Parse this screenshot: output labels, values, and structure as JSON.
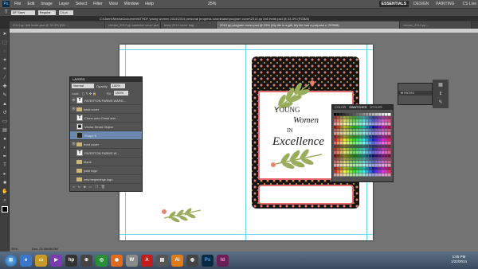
{
  "menubar": {
    "logo": "Ps",
    "items": [
      "File",
      "Edit",
      "Image",
      "Layer",
      "Select",
      "Filter",
      "View",
      "Window",
      "Help"
    ],
    "zoom": "25%",
    "workspaces": [
      "ESSENTIALS",
      "DESIGN",
      "PAINTING"
    ],
    "cs_live": "CS Live"
  },
  "options": {
    "font": "DF Sans",
    "style": "Regular",
    "size": "14 pt"
  },
  "path": "C:\\Users\\Nesha\\Documents\\THDF young women 2014\\2014 personal progress coordinator\\program cover\\2014 pp 4x6 invite.psd @ 33.3% (RGB/8)",
  "tabs": [
    "2014 pp 4x6 invite.psd @ 33.3% (RG…",
    "christo_2014 pp calendar cover.psd",
    "bday 2014 cover bag…",
    "2014 pp program cover.psd @ 25% (My life is a gift, My life has a purpose c, RGB/8)",
    "christo_2014 pp…"
  ],
  "active_tab": 3,
  "cover": {
    "line1": "YOUNG",
    "line2": "Women",
    "line3": "IN",
    "line4": "Excellence"
  },
  "layers": {
    "tabs": [
      "LAYERS"
    ],
    "mode": "Normal",
    "opacity_label": "Opacity:",
    "opacity": "100%",
    "lock_label": "Lock:",
    "fill_label": "Fill:",
    "fill": "100%",
    "rows": [
      {
        "name": "RIVERTON FARMS WARD…",
        "kind": "text"
      },
      {
        "name": "back cover",
        "kind": "folder"
      },
      {
        "name": "Come unto Christ and …",
        "kind": "text"
      },
      {
        "name": "Vector Smart Object",
        "kind": "smart"
      },
      {
        "name": "Shape 6",
        "kind": "shape"
      },
      {
        "name": "front cover",
        "kind": "folder"
      },
      {
        "name": "RIVERTON FARMS W…",
        "kind": "text"
      },
      {
        "name": "blank",
        "kind": "folder"
      },
      {
        "name": "yw/e logo",
        "kind": "folder"
      },
      {
        "name": "new beginnings logo",
        "kind": "folder"
      }
    ]
  },
  "swatches": {
    "tabs": [
      "COLOR",
      "SWATCHES",
      "STYLES"
    ],
    "active": "SWATCHES"
  },
  "paths": {
    "title": "PATHS"
  },
  "status": {
    "zoom": "25%",
    "doc": "Doc: 24.0M/84.0M"
  },
  "clock": {
    "time": "1:05 PM",
    "date": "1/22/2014"
  },
  "colors": {
    "cover_bg": "#151515",
    "frame": "#e86b6b",
    "leaf": "#9aad5c",
    "flower": "#e9836e",
    "guide": "#5fd7e8"
  }
}
